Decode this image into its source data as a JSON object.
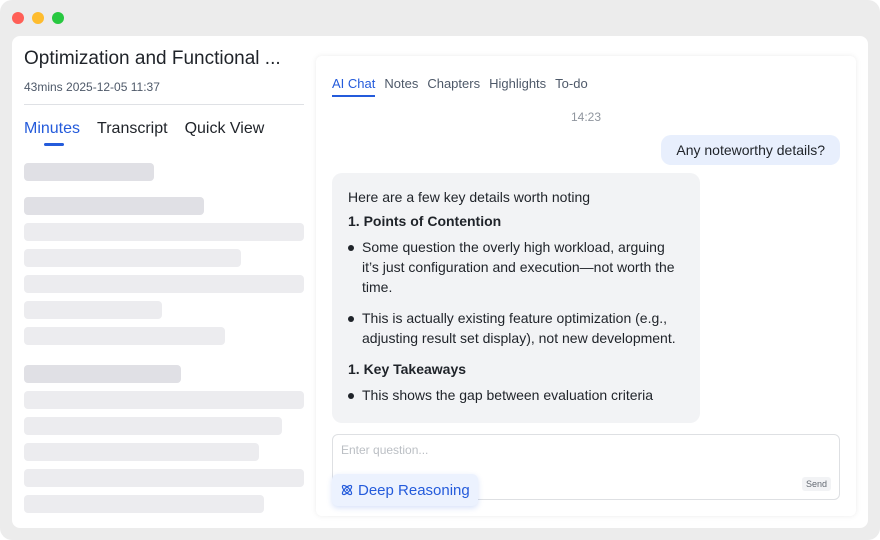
{
  "window": {
    "controls": [
      "close",
      "minimize",
      "maximize"
    ]
  },
  "left": {
    "title": "Optimization and Functional ...",
    "meta": "43mins  2025-12-05 11:37",
    "tabs": [
      {
        "label": "Minutes",
        "active": true
      },
      {
        "label": "Transcript",
        "active": false
      },
      {
        "label": "Quick View",
        "active": false
      }
    ]
  },
  "chat": {
    "tabs": [
      {
        "label": "AI Chat",
        "active": true
      },
      {
        "label": "Notes",
        "active": false
      },
      {
        "label": "Chapters",
        "active": false
      },
      {
        "label": "Highlights",
        "active": false
      },
      {
        "label": "To-do",
        "active": false
      }
    ],
    "time": "14:23",
    "user_message": "Any noteworthy details?",
    "ai_response": {
      "intro": "Here are a few key details worth noting",
      "section1_heading": "1. Points of Contention",
      "section1_items": [
        "Some question the overly high workload, arguing it’s just configuration and execution—not worth the time.",
        "This is actually existing feature optimization (e.g., adjusting result set display), not new development."
      ],
      "section2_heading": "1. Key Takeaways",
      "section2_items": [
        "This shows the gap between evaluation criteria"
      ]
    },
    "input": {
      "placeholder": "Enter question...",
      "value": ""
    },
    "send_label": "Send",
    "deep_reasoning_label": "Deep Reasoning"
  },
  "colors": {
    "accent": "#245bdb",
    "user_bubble": "#e8effd",
    "ai_bubble": "#f2f3f5",
    "skeleton": "#ececef"
  }
}
